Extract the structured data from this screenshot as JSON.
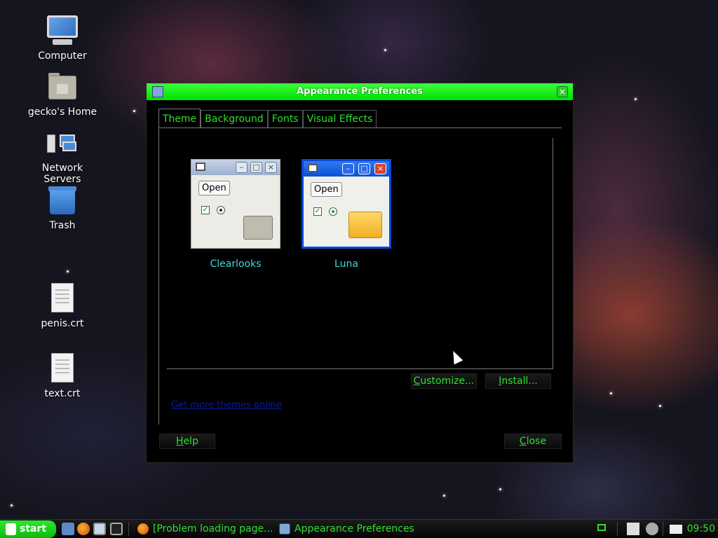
{
  "desktop": {
    "icons": [
      {
        "label": "Computer"
      },
      {
        "label": "gecko's Home"
      },
      {
        "label": "Network Servers"
      },
      {
        "label": "Trash"
      },
      {
        "label": "penis.crt"
      },
      {
        "label": "text.crt"
      }
    ]
  },
  "window": {
    "title": "Appearance Preferences",
    "tabs": [
      "Theme",
      "Background",
      "Fonts",
      "Visual Effects"
    ],
    "active_tab": "Theme",
    "themes": [
      {
        "name": "Clearlooks",
        "preview_button": "Open",
        "selected": false
      },
      {
        "name": "Luna",
        "preview_button": "Open",
        "selected": true
      }
    ],
    "buttons": {
      "customize": {
        "mnemonic": "C",
        "rest": "ustomize..."
      },
      "install": {
        "mnemonic": "I",
        "rest": "nstall..."
      },
      "help": {
        "mnemonic": "H",
        "rest": "elp"
      },
      "close": {
        "mnemonic": "C",
        "rest": "lose"
      }
    },
    "link": "Get more themes online"
  },
  "taskbar": {
    "start_label": "start",
    "tasks": [
      {
        "label": "[Problem loading page..."
      },
      {
        "label": "Appearance Preferences"
      }
    ],
    "clock": "09:50"
  },
  "colors": {
    "accent_green": "#2fe02f",
    "titlebar_green": "#00e000",
    "theme_label": "#3fd8d8",
    "link": "#0a1aa8"
  }
}
